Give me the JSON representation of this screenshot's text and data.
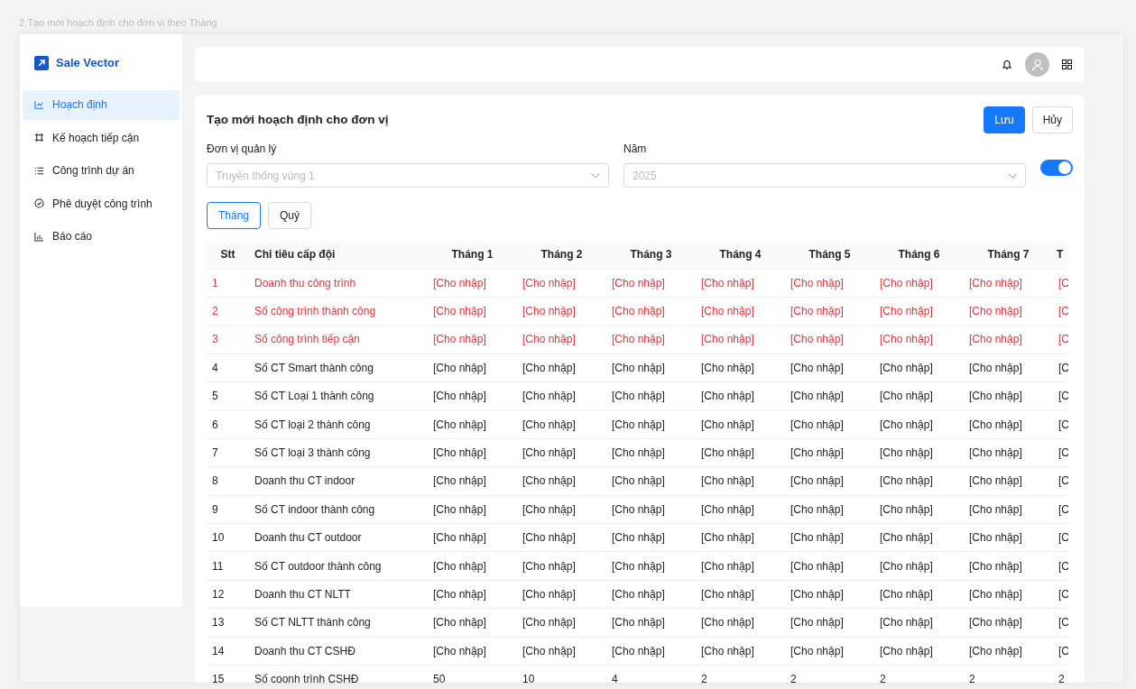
{
  "page_caption": "2.Tạo mới hoạch định cho đơn vị theo Tháng",
  "brand": "Sale Vector",
  "sidebar": {
    "items": [
      {
        "label": "Hoạch định",
        "selected": true
      },
      {
        "label": "Kế hoạch tiếp cận",
        "selected": false
      },
      {
        "label": "Công trình dự án",
        "selected": false
      },
      {
        "label": "Phê duyệt công trình",
        "selected": false
      },
      {
        "label": "Báo cáo",
        "selected": false
      }
    ]
  },
  "form": {
    "title": "Tạo mới hoạch định cho đơn vị",
    "buttons": [
      {
        "label": "Lưu",
        "kind": "primary"
      },
      {
        "label": "Hủy",
        "kind": "secondary"
      }
    ],
    "fields": [
      {
        "label": "Đơn vị quản lý",
        "placeholder": "Truyền thống vùng 1"
      },
      {
        "label": "Năm",
        "placeholder": "2025"
      }
    ],
    "toggle": {
      "on": true
    },
    "period_tabs": [
      {
        "label": "Tháng",
        "selected": true
      },
      {
        "label": "Quý",
        "selected": false
      }
    ]
  },
  "table": {
    "columns": [
      "Stt",
      "Chỉ tiêu cấp đội",
      "Tháng 1",
      "Tháng 2",
      "Tháng 3",
      "Tháng 4",
      "Tháng 5",
      "Tháng 6",
      "Tháng 7",
      "T"
    ],
    "rows": [
      {
        "stt": "1",
        "name": "Doanh thu công trình",
        "required": true,
        "values": [
          "[Cho nhập]",
          "[Cho nhập]",
          "[Cho nhập]",
          "[Cho nhập]",
          "[Cho nhập]",
          "[Cho nhập]",
          "[Cho nhập]",
          "[C"
        ]
      },
      {
        "stt": "2",
        "name": "Số công trình thành công",
        "required": true,
        "values": [
          "[Cho nhập]",
          "[Cho nhập]",
          "[Cho nhập]",
          "[Cho nhập]",
          "[Cho nhập]",
          "[Cho nhập]",
          "[Cho nhập]",
          "[C"
        ]
      },
      {
        "stt": "3",
        "name": "Số công trình tiếp cận",
        "required": true,
        "values": [
          "[Cho nhập]",
          "[Cho nhập]",
          "[Cho nhập]",
          "[Cho nhập]",
          "[Cho nhập]",
          "[Cho nhập]",
          "[Cho nhập]",
          "[C"
        ]
      },
      {
        "stt": "4",
        "name": "Số CT Smart thành công",
        "required": false,
        "values": [
          "[Cho nhập]",
          "[Cho nhập]",
          "[Cho nhập]",
          "[Cho nhập]",
          "[Cho nhập]",
          "[Cho nhập]",
          "[Cho nhập]",
          "[C"
        ]
      },
      {
        "stt": "5",
        "name": "Số CT Loại 1 thành công",
        "required": false,
        "values": [
          "[Cho nhập]",
          "[Cho nhập]",
          "[Cho nhập]",
          "[Cho nhập]",
          "[Cho nhập]",
          "[Cho nhập]",
          "[Cho nhập]",
          "[C"
        ]
      },
      {
        "stt": "6",
        "name": "Số CT loại 2 thành công",
        "required": false,
        "values": [
          "[Cho nhập]",
          "[Cho nhập]",
          "[Cho nhập]",
          "[Cho nhập]",
          "[Cho nhập]",
          "[Cho nhập]",
          "[Cho nhập]",
          "[C"
        ]
      },
      {
        "stt": "7",
        "name": "Số CT loại 3 thành công",
        "required": false,
        "values": [
          "[Cho nhập]",
          "[Cho nhập]",
          "[Cho nhập]",
          "[Cho nhập]",
          "[Cho nhập]",
          "[Cho nhập]",
          "[Cho nhập]",
          "[C"
        ]
      },
      {
        "stt": "8",
        "name": "Doanh thu CT indoor",
        "required": false,
        "values": [
          "[Cho nhập]",
          "[Cho nhập]",
          "[Cho nhập]",
          "[Cho nhập]",
          "[Cho nhập]",
          "[Cho nhập]",
          "[Cho nhập]",
          "[C"
        ]
      },
      {
        "stt": "9",
        "name": "Số CT indoor thành công",
        "required": false,
        "values": [
          "[Cho nhập]",
          "[Cho nhập]",
          "[Cho nhập]",
          "[Cho nhập]",
          "[Cho nhập]",
          "[Cho nhập]",
          "[Cho nhập]",
          "[C"
        ]
      },
      {
        "stt": "10",
        "name": "Doanh thu CT outdoor",
        "required": false,
        "values": [
          "[Cho nhập]",
          "[Cho nhập]",
          "[Cho nhập]",
          "[Cho nhập]",
          "[Cho nhập]",
          "[Cho nhập]",
          "[Cho nhập]",
          "[C"
        ]
      },
      {
        "stt": "11",
        "name": "Số CT outdoor thành công",
        "required": false,
        "values": [
          "[Cho nhập]",
          "[Cho nhập]",
          "[Cho nhập]",
          "[Cho nhập]",
          "[Cho nhập]",
          "[Cho nhập]",
          "[Cho nhập]",
          "[C"
        ]
      },
      {
        "stt": "12",
        "name": "Doanh thu CT NLTT",
        "required": false,
        "values": [
          "[Cho nhập]",
          "[Cho nhập]",
          "[Cho nhập]",
          "[Cho nhập]",
          "[Cho nhập]",
          "[Cho nhập]",
          "[Cho nhập]",
          "[C"
        ]
      },
      {
        "stt": "13",
        "name": "Số CT NLTT thành công",
        "required": false,
        "values": [
          "[Cho nhập]",
          "[Cho nhập]",
          "[Cho nhập]",
          "[Cho nhập]",
          "[Cho nhập]",
          "[Cho nhập]",
          "[Cho nhập]",
          "[C"
        ]
      },
      {
        "stt": "14",
        "name": "Doanh thu CT CSHĐ",
        "required": false,
        "values": [
          "[Cho nhập]",
          "[Cho nhập]",
          "[Cho nhập]",
          "[Cho nhập]",
          "[Cho nhập]",
          "[Cho nhập]",
          "[Cho nhập]",
          "[C"
        ]
      },
      {
        "stt": "15",
        "name": "Số coonh trình CSHĐ",
        "required": false,
        "values": [
          "50",
          "10",
          "4",
          "2",
          "2",
          "2",
          "2",
          "2"
        ]
      }
    ]
  }
}
